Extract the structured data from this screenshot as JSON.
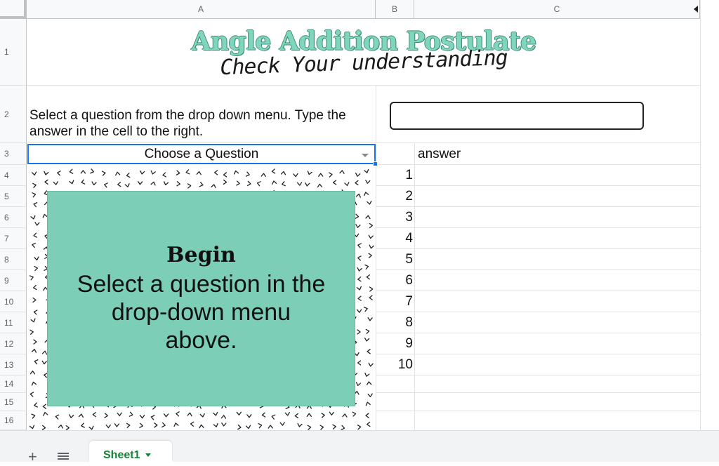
{
  "columns": [
    "A",
    "B",
    "C"
  ],
  "rows": [
    "1",
    "2",
    "3",
    "4",
    "5",
    "6",
    "7",
    "8",
    "9",
    "10",
    "11",
    "12",
    "13",
    "14",
    "15",
    "16"
  ],
  "title": {
    "main": "Angle Addition Postulate",
    "sub": "Check Your understanding"
  },
  "instructions": "Select a question from the drop down menu. Type the answer in the cell to the right.",
  "dropdown": {
    "selected": "Choose a Question"
  },
  "answer_header": "answer",
  "question_numbers": [
    "1",
    "2",
    "3",
    "4",
    "5",
    "6",
    "7",
    "8",
    "9",
    "10"
  ],
  "card": {
    "title": "Begin",
    "body": "Select a question in the drop-down menu above."
  },
  "tabs": {
    "add_label": "+",
    "sheet_name": "Sheet1"
  },
  "colors": {
    "card_bg": "#7ccfb6",
    "title_green": "#7fd6bd",
    "selection_blue": "#1a73e8",
    "tab_green": "#188038"
  }
}
